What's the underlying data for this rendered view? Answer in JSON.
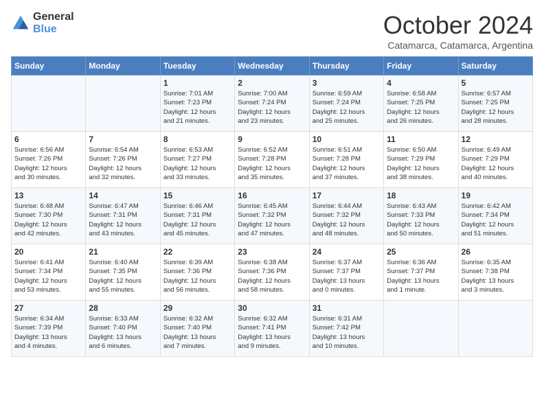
{
  "header": {
    "logo_line1": "General",
    "logo_line2": "Blue",
    "month": "October 2024",
    "location": "Catamarca, Catamarca, Argentina"
  },
  "columns": [
    "Sunday",
    "Monday",
    "Tuesday",
    "Wednesday",
    "Thursday",
    "Friday",
    "Saturday"
  ],
  "weeks": [
    [
      {
        "day": "",
        "info": ""
      },
      {
        "day": "",
        "info": ""
      },
      {
        "day": "1",
        "info": "Sunrise: 7:01 AM\nSunset: 7:23 PM\nDaylight: 12 hours\nand 21 minutes."
      },
      {
        "day": "2",
        "info": "Sunrise: 7:00 AM\nSunset: 7:24 PM\nDaylight: 12 hours\nand 23 minutes."
      },
      {
        "day": "3",
        "info": "Sunrise: 6:59 AM\nSunset: 7:24 PM\nDaylight: 12 hours\nand 25 minutes."
      },
      {
        "day": "4",
        "info": "Sunrise: 6:58 AM\nSunset: 7:25 PM\nDaylight: 12 hours\nand 26 minutes."
      },
      {
        "day": "5",
        "info": "Sunrise: 6:57 AM\nSunset: 7:25 PM\nDaylight: 12 hours\nand 28 minutes."
      }
    ],
    [
      {
        "day": "6",
        "info": "Sunrise: 6:56 AM\nSunset: 7:26 PM\nDaylight: 12 hours\nand 30 minutes."
      },
      {
        "day": "7",
        "info": "Sunrise: 6:54 AM\nSunset: 7:26 PM\nDaylight: 12 hours\nand 32 minutes."
      },
      {
        "day": "8",
        "info": "Sunrise: 6:53 AM\nSunset: 7:27 PM\nDaylight: 12 hours\nand 33 minutes."
      },
      {
        "day": "9",
        "info": "Sunrise: 6:52 AM\nSunset: 7:28 PM\nDaylight: 12 hours\nand 35 minutes."
      },
      {
        "day": "10",
        "info": "Sunrise: 6:51 AM\nSunset: 7:28 PM\nDaylight: 12 hours\nand 37 minutes."
      },
      {
        "day": "11",
        "info": "Sunrise: 6:50 AM\nSunset: 7:29 PM\nDaylight: 12 hours\nand 38 minutes."
      },
      {
        "day": "12",
        "info": "Sunrise: 6:49 AM\nSunset: 7:29 PM\nDaylight: 12 hours\nand 40 minutes."
      }
    ],
    [
      {
        "day": "13",
        "info": "Sunrise: 6:48 AM\nSunset: 7:30 PM\nDaylight: 12 hours\nand 42 minutes."
      },
      {
        "day": "14",
        "info": "Sunrise: 6:47 AM\nSunset: 7:31 PM\nDaylight: 12 hours\nand 43 minutes."
      },
      {
        "day": "15",
        "info": "Sunrise: 6:46 AM\nSunset: 7:31 PM\nDaylight: 12 hours\nand 45 minutes."
      },
      {
        "day": "16",
        "info": "Sunrise: 6:45 AM\nSunset: 7:32 PM\nDaylight: 12 hours\nand 47 minutes."
      },
      {
        "day": "17",
        "info": "Sunrise: 6:44 AM\nSunset: 7:32 PM\nDaylight: 12 hours\nand 48 minutes."
      },
      {
        "day": "18",
        "info": "Sunrise: 6:43 AM\nSunset: 7:33 PM\nDaylight: 12 hours\nand 50 minutes."
      },
      {
        "day": "19",
        "info": "Sunrise: 6:42 AM\nSunset: 7:34 PM\nDaylight: 12 hours\nand 51 minutes."
      }
    ],
    [
      {
        "day": "20",
        "info": "Sunrise: 6:41 AM\nSunset: 7:34 PM\nDaylight: 12 hours\nand 53 minutes."
      },
      {
        "day": "21",
        "info": "Sunrise: 6:40 AM\nSunset: 7:35 PM\nDaylight: 12 hours\nand 55 minutes."
      },
      {
        "day": "22",
        "info": "Sunrise: 6:39 AM\nSunset: 7:36 PM\nDaylight: 12 hours\nand 56 minutes."
      },
      {
        "day": "23",
        "info": "Sunrise: 6:38 AM\nSunset: 7:36 PM\nDaylight: 12 hours\nand 58 minutes."
      },
      {
        "day": "24",
        "info": "Sunrise: 6:37 AM\nSunset: 7:37 PM\nDaylight: 13 hours\nand 0 minutes."
      },
      {
        "day": "25",
        "info": "Sunrise: 6:36 AM\nSunset: 7:37 PM\nDaylight: 13 hours\nand 1 minute."
      },
      {
        "day": "26",
        "info": "Sunrise: 6:35 AM\nSunset: 7:38 PM\nDaylight: 13 hours\nand 3 minutes."
      }
    ],
    [
      {
        "day": "27",
        "info": "Sunrise: 6:34 AM\nSunset: 7:39 PM\nDaylight: 13 hours\nand 4 minutes."
      },
      {
        "day": "28",
        "info": "Sunrise: 6:33 AM\nSunset: 7:40 PM\nDaylight: 13 hours\nand 6 minutes."
      },
      {
        "day": "29",
        "info": "Sunrise: 6:32 AM\nSunset: 7:40 PM\nDaylight: 13 hours\nand 7 minutes."
      },
      {
        "day": "30",
        "info": "Sunrise: 6:32 AM\nSunset: 7:41 PM\nDaylight: 13 hours\nand 9 minutes."
      },
      {
        "day": "31",
        "info": "Sunrise: 6:31 AM\nSunset: 7:42 PM\nDaylight: 13 hours\nand 10 minutes."
      },
      {
        "day": "",
        "info": ""
      },
      {
        "day": "",
        "info": ""
      }
    ]
  ]
}
